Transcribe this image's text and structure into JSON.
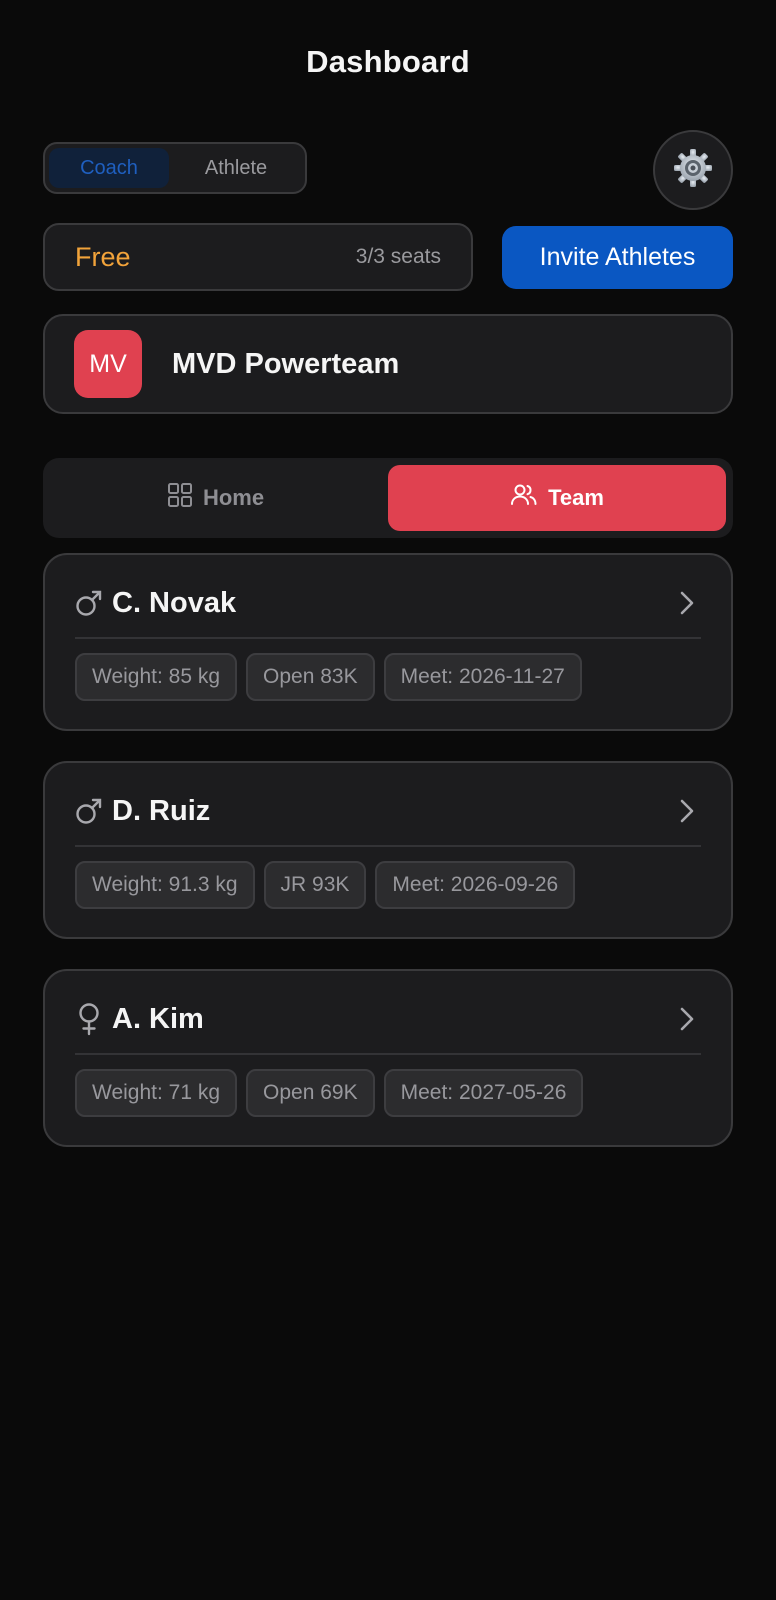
{
  "header": {
    "title": "Dashboard"
  },
  "role_toggle": {
    "options": [
      "Coach",
      "Athlete"
    ],
    "selected": "Coach"
  },
  "plan": {
    "name": "Free",
    "seats": "3/3 seats"
  },
  "invite_label": "Invite Athletes",
  "team": {
    "initials": "MV",
    "name": "MVD Powerteam"
  },
  "nav": {
    "tabs": [
      {
        "label": "Home",
        "icon": "grid-icon"
      },
      {
        "label": "Team",
        "icon": "users-icon"
      }
    ],
    "active": "Team"
  },
  "athletes": [
    {
      "name": "C. Novak",
      "gender": "male",
      "chips": [
        "Weight: 85 kg",
        "Open 83K",
        "Meet: 2026-11-27"
      ]
    },
    {
      "name": "D. Ruiz",
      "gender": "male",
      "chips": [
        "Weight: 91.3 kg",
        "JR 93K",
        "Meet: 2026-09-26"
      ]
    },
    {
      "name": "A. Kim",
      "gender": "female",
      "chips": [
        "Weight: 71 kg",
        "Open 69K",
        "Meet: 2027-05-26"
      ]
    }
  ],
  "colors": {
    "accent_red": "#e04150",
    "accent_blue": "#0a57c2",
    "plan_orange": "#f2a33a",
    "background": "#0a0a0a",
    "card": "#1c1c1e"
  }
}
